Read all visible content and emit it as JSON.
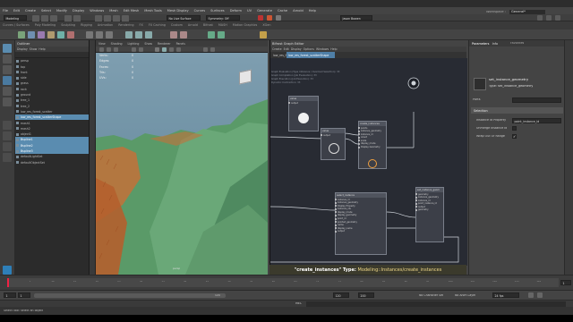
{
  "menubar": {
    "items": [
      "File",
      "Edit",
      "Create",
      "Select",
      "Modify",
      "Display",
      "Windows",
      "Mesh",
      "Edit Mesh",
      "Mesh Tools",
      "Mesh Display",
      "Curves",
      "Surfaces",
      "Deform",
      "UV",
      "Generate",
      "Cache",
      "Arnold",
      "Help"
    ],
    "workspace_label": "Workspace :",
    "workspace_value": "General*"
  },
  "statusline": {
    "mode": "Modeling",
    "no_live_surface": "No Live Surface",
    "symmetry": "Symmetry: Off",
    "user": "Jason Bowen"
  },
  "shelf_tabs": [
    "Curves / Surfaces",
    "Poly Modeling",
    "Sculpting",
    "Rigging",
    "Animation",
    "Rendering",
    "FX",
    "FX Caching",
    "Custom",
    "Arnold",
    "Bifrost",
    "MASH",
    "Motion Graphics",
    "XGen"
  ],
  "outliner": {
    "title": "Outliner",
    "menu": [
      "Display",
      "Show",
      "Help"
    ],
    "items": [
      {
        "label": "persp",
        "selected": false
      },
      {
        "label": "top",
        "selected": false
      },
      {
        "label": "front",
        "selected": false
      },
      {
        "label": "side",
        "selected": false
      },
      {
        "label": "grass",
        "selected": false
      },
      {
        "label": "rock",
        "selected": false
      },
      {
        "label": "ground",
        "selected": false
      },
      {
        "label": "tree_1",
        "selected": false
      },
      {
        "label": "tree_2",
        "selected": false
      },
      {
        "label": "low_res_forest_scatter",
        "selected": false
      },
      {
        "label": "low_res_forest_scatterShape",
        "selected": true
      },
      {
        "label": "mash1",
        "selected": false
      },
      {
        "label": "mash2",
        "selected": false
      },
      {
        "label": "object1",
        "selected": false
      },
      {
        "label": "Bspline1",
        "selected": true
      },
      {
        "label": "Bspline2",
        "selected": true
      },
      {
        "label": "Bspline3",
        "selected": true
      },
      {
        "label": "defaultLightSet",
        "selected": false
      },
      {
        "label": "defaultObjectSet",
        "selected": false
      }
    ]
  },
  "viewport": {
    "menu": [
      "View",
      "Shading",
      "Lighting",
      "Show",
      "Renderer",
      "Panels"
    ],
    "hud_labels": [
      "Verts:",
      "Edges:",
      "Faces:",
      "Tris:",
      "UVs:"
    ],
    "hud_values": [
      "0",
      "0",
      "0",
      "0",
      "0"
    ],
    "camera_label": "persp"
  },
  "graph_editor": {
    "title": "Bifrost Graph Editor",
    "menu": [
      "Create",
      "Edit",
      "Display",
      "Options",
      "Windows",
      "Help"
    ],
    "tabs": [
      "low_res_forest_scatterShape",
      "low_res_forest_scatterShape"
    ],
    "info_lines": [
      "Graph Evaluation (Type Inference / Overload Selection): 33",
      "Graph Compilation (Job Evaluation): 33",
      "Graph Execution (Job Execution): 33",
      "Dynamic Contraction: 33"
    ],
    "nodes": {
      "n1": {
        "title": "value",
        "ports": [
          "output"
        ]
      },
      "n2": {
        "title": "create_instances",
        "ports": [
          "points",
          "instance_geometry",
          "instance_id",
          "orient",
          "scale",
          "display_mode",
          "Display Geometry"
        ]
      },
      "n3": {
        "title": "value",
        "ports": [
          "output"
        ]
      },
      "n4": {
        "title": "select_instance",
        "ports": [
          "instance_id",
          "instance_geometry",
          "Display Property",
          "instance_ids",
          "display_mode",
          "display_geometry",
          "point_id",
          "pointed_geometry",
          "name",
          "display_name",
          "output"
        ]
      },
      "n5": {
        "title": "set_instance_geom",
        "ports": [
          "geometry",
          "instance_geometry",
          "instance_id",
          "point_instance_id",
          "output",
          "geometry"
        ]
      }
    },
    "caption_name": "\"create_instances\"",
    "caption_type_label": "Type:",
    "caption_type": "Modeling::Instances/create_instances"
  },
  "attribute_editor": {
    "tabs": [
      "Parameters",
      "Info"
    ],
    "tab_right": "Favorites",
    "node_name": "set_instance_geometry",
    "node_type": "Type: set_instance_geometry",
    "ports_label": "Ports",
    "section": "Selection",
    "rows": [
      {
        "label": "Instance Id Property",
        "value": "point_instance_id"
      },
      {
        "label": "Unmerge Instance Id",
        "value": ""
      },
      {
        "label": "Wrap Out Of Range",
        "value": ""
      }
    ],
    "wrap_checked": true
  },
  "timeline": {
    "ticks": [
      "5",
      "10",
      "15",
      "20",
      "25",
      "30",
      "35",
      "40",
      "45",
      "50",
      "55",
      "60",
      "65",
      "70",
      "75",
      "80",
      "85",
      "90",
      "95",
      "100",
      "105",
      "110",
      "115",
      "120"
    ],
    "current_frame": "1"
  },
  "range": {
    "start": "1",
    "inner_start": "1",
    "inner_end": "120",
    "end": "120",
    "anim_end": "200",
    "character_set": "No Character Set",
    "anim_layer": "No Anim Layer",
    "fps": "24 fps"
  },
  "command_line": {
    "label": "MEL"
  },
  "help_line": {
    "text": "Select Tool: select an object"
  },
  "colors": {
    "accent": "#5a8cb0",
    "caption_text": "#f0d98a",
    "sky": "#6f93a6",
    "terrain": "#5f9f6f",
    "water": "#1fb3c0"
  }
}
